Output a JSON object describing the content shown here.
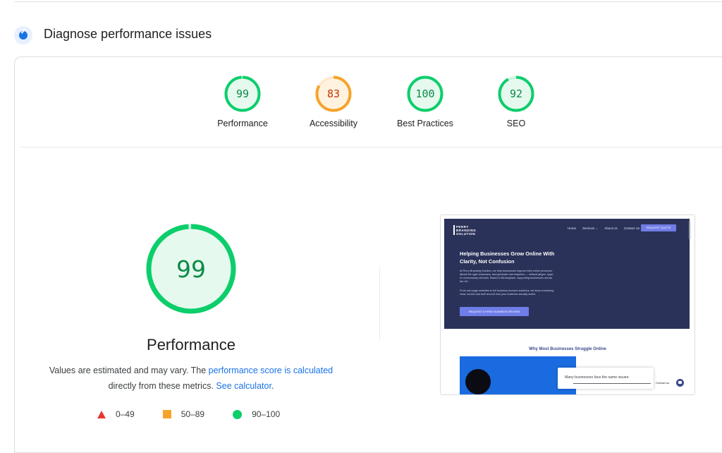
{
  "section": {
    "title": "Diagnose performance issues"
  },
  "scores": [
    {
      "label": "Performance",
      "value": "99",
      "score": 99,
      "color": "#0cce6b",
      "text_color": "#0a8a46",
      "bg": "#e6f9ee"
    },
    {
      "label": "Accessibility",
      "value": "83",
      "score": 83,
      "color": "#f6a32b",
      "text_color": "#c33300",
      "bg": "#fff3e0"
    },
    {
      "label": "Best Practices",
      "value": "100",
      "score": 100,
      "color": "#0cce6b",
      "text_color": "#0a8a46",
      "bg": "#e6f9ee"
    },
    {
      "label": "SEO",
      "value": "92",
      "score": 92,
      "color": "#0cce6b",
      "text_color": "#0a8a46",
      "bg": "#e6f9ee"
    }
  ],
  "main": {
    "score": "99",
    "score_value": 99,
    "title": "Performance",
    "desc_prefix": "Values are estimated and may vary. The ",
    "desc_link": "performance score is calculated",
    "desc_middle": "directly from these metrics. ",
    "desc_link2": "See calculator",
    "desc_suffix": "."
  },
  "legend": [
    {
      "range": "0–49",
      "icon": "triangle-icon",
      "color": "#e53935"
    },
    {
      "range": "50–89",
      "icon": "square-icon",
      "color": "#f6a32b"
    },
    {
      "range": "90–100",
      "icon": "circle-icon",
      "color": "#0cce6b"
    }
  ],
  "screenshot": {
    "logo_line1": "PERRY",
    "logo_line2": "BRANDING",
    "logo_line3": "SOLUTION",
    "nav": [
      "Home",
      "Services ⌄",
      "About Us",
      "Contact Us"
    ],
    "nav_button": "REQUEST QUOTE",
    "headline": "Helping Businesses Grow Online With Clarity, Not Confusion",
    "para1": "At Perry Branding Solution, we help businesses improve their online presence, attract the right customers, and generate real enquiries — without jargon, hype, or unnecessary services. Based in Birmingham, supporting businesses across the UK.",
    "para2": "From one-page websites to full business-focused solutions, we keep everything clear, honest and built around how your business actually works.",
    "cta": "REQUEST A FREE BUSINESS REVIEW",
    "why_title": "Why Most Businesses Struggle Online",
    "popup_text": "Many businesses face the same issues:",
    "contact": "Contact us"
  }
}
